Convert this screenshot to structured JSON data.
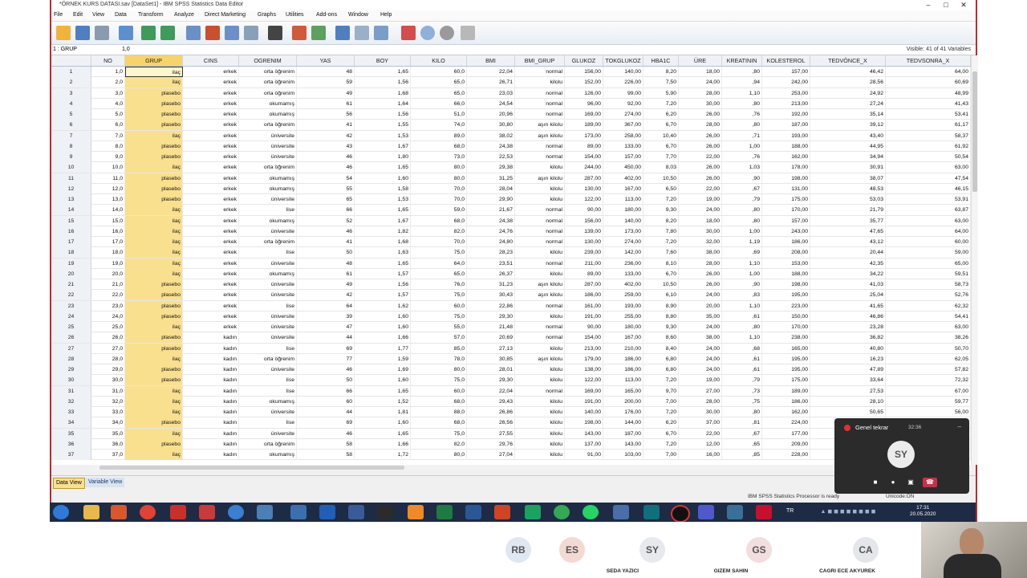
{
  "window": {
    "title": "*ÖRNEK KURS DATASI.sav [DataSet1] - IBM SPSS Statistics Data Editor",
    "controls": [
      "–",
      "□",
      "✕"
    ]
  },
  "menu": [
    "File",
    "Edit",
    "View",
    "Data",
    "Transform",
    "Analyze",
    "Direct Marketing",
    "Graphs",
    "Utilities",
    "Add-ons",
    "Window",
    "Help"
  ],
  "editbar": {
    "cell_ref": "1 : GRUP",
    "cell_value": "1,0",
    "visible": "Visible: 41 of 41 Variables"
  },
  "columns": [
    "NO",
    "GRUP",
    "CINS",
    "OGRENIM",
    "YAS",
    "BOY",
    "KILO",
    "BMI",
    "BMI_GRUP",
    "GLUKOZ",
    "TOKGLUKOZ",
    "HBA1C",
    "ÜRE",
    "KREATININ",
    "KOLESTEROL",
    "TEDVÖNCE_X",
    "TEDVSONRA_X"
  ],
  "rows": [
    [
      "1",
      "1,0",
      "ilaç",
      "erkek",
      "orta öğrenim",
      "48",
      "1,65",
      "60,0",
      "22,04",
      "normal",
      "156,00",
      "140,00",
      "8,20",
      "18,00",
      ",80",
      "157,00",
      "46,42",
      "64,00"
    ],
    [
      "2",
      "2,0",
      "ilaç",
      "erkek",
      "orta öğrenim",
      "59",
      "1,56",
      "65,0",
      "26,71",
      "kilolu",
      "152,00",
      "226,00",
      "7,50",
      "24,00",
      ",94",
      "242,00",
      "28,56",
      "60,69"
    ],
    [
      "3",
      "3,0",
      "plasebo",
      "erkek",
      "orta öğrenim",
      "49",
      "1,68",
      "65,0",
      "23,03",
      "normal",
      "126,00",
      "99,00",
      "5,90",
      "28,00",
      "1,10",
      "253,00",
      "24,92",
      "48,99"
    ],
    [
      "4",
      "4,0",
      "plasebo",
      "erkek",
      "okumamış",
      "61",
      "1,64",
      "66,0",
      "24,54",
      "normal",
      "96,00",
      "92,00",
      "7,20",
      "30,00",
      ",80",
      "213,00",
      "27,24",
      "41,43"
    ],
    [
      "5",
      "5,0",
      "plasebo",
      "erkek",
      "okumamış",
      "56",
      "1,56",
      "51,0",
      "20,96",
      "normal",
      "169,00",
      "274,00",
      "6,20",
      "26,00",
      ",76",
      "192,00",
      "35,14",
      "53,41"
    ],
    [
      "6",
      "6,0",
      "plasebo",
      "erkek",
      "orta öğrenim",
      "41",
      "1,55",
      "74,0",
      "30,80",
      "aşırı kilolu",
      "189,00",
      "367,00",
      "6,70",
      "28,00",
      ",80",
      "187,00",
      "39,12",
      "61,17"
    ],
    [
      "7",
      "7,0",
      "ilaç",
      "erkek",
      "üniversite",
      "42",
      "1,53",
      "89,0",
      "38,02",
      "aşırı kilolu",
      "173,00",
      "258,00",
      "10,40",
      "26,00",
      ",71",
      "193,00",
      "43,40",
      "58,37"
    ],
    [
      "8",
      "8,0",
      "plasebo",
      "erkek",
      "üniversite",
      "43",
      "1,67",
      "68,0",
      "24,38",
      "normal",
      "89,00",
      "133,00",
      "6,70",
      "26,00",
      "1,00",
      "188,00",
      "44,95",
      "61,92"
    ],
    [
      "9",
      "9,0",
      "plasebo",
      "erkek",
      "üniversite",
      "46",
      "1,80",
      "73,0",
      "22,53",
      "normal",
      "154,00",
      "157,00",
      "7,70",
      "22,00",
      ",76",
      "162,00",
      "34,94",
      "50,54"
    ],
    [
      "10",
      "10,0",
      "ilaç",
      "erkek",
      "orta öğrenim",
      "46",
      "1,65",
      "80,0",
      "29,38",
      "kilolu",
      "244,00",
      "450,00",
      "8,03",
      "26,00",
      "1,03",
      "178,00",
      "30,91",
      "63,00"
    ],
    [
      "11",
      "11,0",
      "plasebo",
      "erkek",
      "okumamış",
      "54",
      "1,60",
      "80,0",
      "31,25",
      "aşırı kilolu",
      "287,00",
      "402,00",
      "10,50",
      "26,00",
      ",90",
      "198,00",
      "38,07",
      "47,54"
    ],
    [
      "12",
      "12,0",
      "plasebo",
      "erkek",
      "okumamış",
      "55",
      "1,58",
      "70,0",
      "28,04",
      "kilolu",
      "130,00",
      "167,00",
      "6,50",
      "22,00",
      ",67",
      "131,00",
      "48,53",
      "46,15"
    ],
    [
      "13",
      "13,0",
      "plasebo",
      "erkek",
      "üniversite",
      "65",
      "1,53",
      "70,0",
      "29,90",
      "kilolu",
      "122,00",
      "113,00",
      "7,20",
      "19,00",
      ",79",
      "175,00",
      "53,03",
      "53,91"
    ],
    [
      "14",
      "14,0",
      "ilaç",
      "erkek",
      "lise",
      "66",
      "1,65",
      "59,0",
      "21,67",
      "normal",
      "90,00",
      "180,00",
      "9,30",
      "24,00",
      ",80",
      "170,00",
      "21,79",
      "63,87"
    ],
    [
      "15",
      "15,0",
      "ilaç",
      "erkek",
      "okumamış",
      "52",
      "1,67",
      "68,0",
      "24,38",
      "normal",
      "156,00",
      "140,00",
      "8,20",
      "18,00",
      ",80",
      "157,00",
      "35,77",
      "63,00"
    ],
    [
      "16",
      "16,0",
      "ilaç",
      "erkek",
      "üniversite",
      "46",
      "1,82",
      "82,0",
      "24,76",
      "normal",
      "139,00",
      "173,00",
      "7,80",
      "30,00",
      "1,00",
      "243,00",
      "47,65",
      "64,00"
    ],
    [
      "17",
      "17,0",
      "ilaç",
      "erkek",
      "orta öğrenim",
      "41",
      "1,68",
      "70,0",
      "24,80",
      "normal",
      "130,00",
      "274,00",
      "7,20",
      "32,00",
      "1,19",
      "186,00",
      "43,12",
      "60,00"
    ],
    [
      "18",
      "18,0",
      "ilaç",
      "erkek",
      "lise",
      "50",
      "1,63",
      "75,0",
      "28,23",
      "kilolu",
      "239,00",
      "142,00",
      "7,60",
      "38,00",
      ",69",
      "208,00",
      "20,44",
      "59,00"
    ],
    [
      "19",
      "19,0",
      "ilaç",
      "erkek",
      "üniversite",
      "48",
      "1,65",
      "64,0",
      "23,51",
      "normal",
      "211,00",
      "236,00",
      "8,10",
      "28,00",
      "1,10",
      "153,00",
      "42,35",
      "65,00"
    ],
    [
      "20",
      "20,0",
      "ilaç",
      "erkek",
      "okumamış",
      "61",
      "1,57",
      "65,0",
      "26,37",
      "kilolu",
      "89,00",
      "133,00",
      "6,70",
      "26,00",
      "1,00",
      "188,00",
      "34,22",
      "59,51"
    ],
    [
      "21",
      "21,0",
      "plasebo",
      "erkek",
      "üniversite",
      "49",
      "1,56",
      "76,0",
      "31,23",
      "aşırı kilolu",
      "287,00",
      "402,00",
      "10,50",
      "26,00",
      ",90",
      "198,00",
      "41,03",
      "58,73"
    ],
    [
      "22",
      "22,0",
      "plasebo",
      "erkek",
      "üniversite",
      "42",
      "1,57",
      "75,0",
      "30,43",
      "aşırı kilolu",
      "186,00",
      "259,00",
      "6,10",
      "24,00",
      ",83",
      "195,00",
      "25,04",
      "52,76"
    ],
    [
      "23",
      "23,0",
      "plasebo",
      "erkek",
      "lise",
      "64",
      "1,62",
      "60,0",
      "22,86",
      "normal",
      "161,00",
      "193,00",
      "8,90",
      "20,00",
      "1,10",
      "223,00",
      "41,65",
      "62,32"
    ],
    [
      "24",
      "24,0",
      "plasebo",
      "erkek",
      "üniversite",
      "39",
      "1,60",
      "75,0",
      "29,30",
      "kilolu",
      "191,00",
      "255,00",
      "8,80",
      "35,00",
      ",61",
      "150,00",
      "46,86",
      "54,41"
    ],
    [
      "25",
      "25,0",
      "ilaç",
      "erkek",
      "üniversite",
      "47",
      "1,60",
      "55,0",
      "21,48",
      "normal",
      "90,00",
      "180,00",
      "9,30",
      "24,00",
      ",80",
      "170,00",
      "23,28",
      "63,00"
    ],
    [
      "26",
      "26,0",
      "plasebo",
      "kadın",
      "üniversite",
      "44",
      "1,66",
      "57,0",
      "20,69",
      "normal",
      "154,00",
      "167,00",
      "8,60",
      "38,00",
      "1,10",
      "238,00",
      "36,82",
      "38,26"
    ],
    [
      "27",
      "27,0",
      "plasebo",
      "kadın",
      "lise",
      "69",
      "1,77",
      "85,0",
      "27,13",
      "kilolu",
      "213,00",
      "210,00",
      "8,40",
      "24,00",
      ",68",
      "165,00",
      "40,80",
      "50,70"
    ],
    [
      "28",
      "28,0",
      "ilaç",
      "kadın",
      "orta öğrenim",
      "77",
      "1,59",
      "78,0",
      "30,85",
      "aşırı kilolu",
      "179,00",
      "186,00",
      "6,80",
      "24,00",
      ",61",
      "195,00",
      "16,23",
      "62,05"
    ],
    [
      "29",
      "29,0",
      "plasebo",
      "kadın",
      "üniversite",
      "46",
      "1,69",
      "80,0",
      "28,01",
      "kilolu",
      "138,00",
      "186,00",
      "6,80",
      "24,00",
      ",61",
      "195,00",
      "47,89",
      "57,82"
    ],
    [
      "30",
      "30,0",
      "plasebo",
      "kadın",
      "lise",
      "50",
      "1,60",
      "75,0",
      "29,30",
      "kilolu",
      "122,00",
      "113,00",
      "7,20",
      "19,00",
      ",79",
      "175,00",
      "33,64",
      "72,32"
    ],
    [
      "31",
      "31,0",
      "ilaç",
      "kadın",
      "lise",
      "66",
      "1,65",
      "60,0",
      "22,04",
      "normal",
      "169,00",
      "165,00",
      "9,70",
      "27,00",
      ",73",
      "189,00",
      "27,53",
      "67,00"
    ],
    [
      "32",
      "32,0",
      "ilaç",
      "kadın",
      "okumamış",
      "60",
      "1,52",
      "68,0",
      "29,43",
      "kilolu",
      "191,00",
      "200,00",
      "7,00",
      "28,00",
      ",75",
      "186,00",
      "28,10",
      "59,77"
    ],
    [
      "33",
      "33,0",
      "ilaç",
      "kadın",
      "üniversite",
      "44",
      "1,81",
      "88,0",
      "26,86",
      "kilolu",
      "140,00",
      "176,00",
      "7,20",
      "30,00",
      ",80",
      "162,00",
      "50,65",
      "56,00"
    ],
    [
      "34",
      "34,0",
      "plasebo",
      "kadın",
      "lise",
      "69",
      "1,60",
      "68,0",
      "26,56",
      "kilolu",
      "198,00",
      "144,00",
      "6,20",
      "37,00",
      ",81",
      "224,00",
      "",
      ""
    ],
    [
      "35",
      "35,0",
      "ilaç",
      "kadın",
      "üniversite",
      "46",
      "1,65",
      "75,0",
      "27,55",
      "kilolu",
      "143,00",
      "187,00",
      "6,70",
      "22,00",
      ",67",
      "177,00",
      "",
      ""
    ],
    [
      "36",
      "36,0",
      "plasebo",
      "kadın",
      "orta öğrenim",
      "58",
      "1,66",
      "82,0",
      "29,76",
      "kilolu",
      "137,00",
      "143,00",
      "7,20",
      "12,00",
      ",65",
      "209,00",
      "",
      ""
    ],
    [
      "37",
      "37,0",
      "ilaç",
      "kadın",
      "okumamış",
      "58",
      "1,72",
      "80,0",
      "27,04",
      "kilolu",
      "91,00",
      "103,00",
      "7,00",
      "16,00",
      ",85",
      "228,00",
      "",
      ""
    ]
  ],
  "tabs": {
    "data_view": "Data View",
    "variable_view": "Variable View"
  },
  "status": {
    "processor": "IBM SPSS Statistics Processor is ready",
    "unicode": "Unicode:ON"
  },
  "taskbar": {
    "lang": "TR",
    "time": "17:31",
    "date": "20.05.2020"
  },
  "call": {
    "title": "Genel tekrar",
    "duration": "32:36",
    "avatar": "SY"
  },
  "participants": [
    {
      "initials": "RB",
      "name": ""
    },
    {
      "initials": "ES",
      "name": ""
    },
    {
      "initials": "SY",
      "name": "SEDA YAZICI"
    },
    {
      "initials": "GS",
      "name": "GIZEM SAHIN"
    },
    {
      "initials": "CA",
      "name": "CAGRI ECE AKYUREK"
    }
  ],
  "colors": {
    "accent": "#c0282c",
    "group_highlight": "#f9e08f",
    "taskbar": "#1d2b45"
  }
}
